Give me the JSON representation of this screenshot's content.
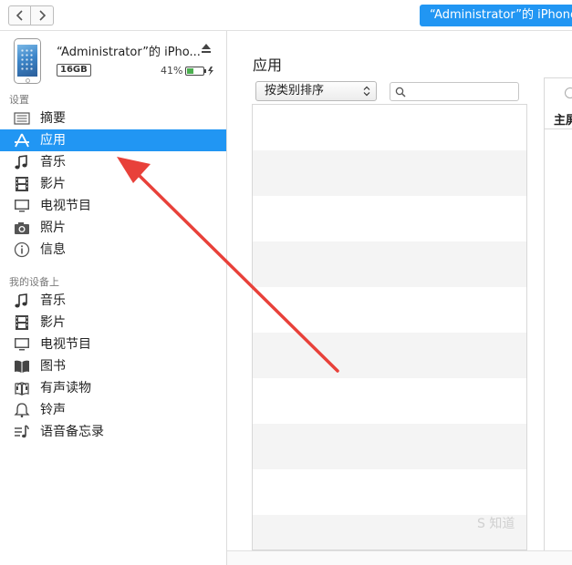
{
  "toolbar": {
    "back_icon": "chevron-left-icon",
    "forward_icon": "chevron-right-icon",
    "device_button_label": "“Administrator”的 iPhone"
  },
  "device": {
    "name": "“Administrator”的 iPho...",
    "capacity": "16GB",
    "battery_percent": "41%",
    "battery_level": 0.41,
    "eject_icon": "eject-icon"
  },
  "sidebar": {
    "settings_label": "设置",
    "settings_items": [
      {
        "label": "摘要",
        "icon": "list-icon"
      },
      {
        "label": "应用",
        "icon": "app-store-icon",
        "active": true
      },
      {
        "label": "音乐",
        "icon": "music-note-icon"
      },
      {
        "label": "影片",
        "icon": "film-icon"
      },
      {
        "label": "电视节目",
        "icon": "tv-icon"
      },
      {
        "label": "照片",
        "icon": "camera-icon"
      },
      {
        "label": "信息",
        "icon": "info-icon"
      }
    ],
    "device_label": "我的设备上",
    "device_items": [
      {
        "label": "音乐",
        "icon": "music-note-icon"
      },
      {
        "label": "影片",
        "icon": "film-icon"
      },
      {
        "label": "电视节目",
        "icon": "tv-icon"
      },
      {
        "label": "图书",
        "icon": "book-icon"
      },
      {
        "label": "有声读物",
        "icon": "audiobook-icon"
      },
      {
        "label": "铃声",
        "icon": "bell-icon"
      },
      {
        "label": "语音备忘录",
        "icon": "voice-memo-icon"
      }
    ]
  },
  "main": {
    "title": "应用",
    "sort_select": "按类别排序",
    "search_placeholder": "",
    "home_screen_label": "主屏"
  },
  "watermark": "S 知道",
  "colors": {
    "accent": "#2196f3",
    "annotation_arrow": "#e8413a",
    "battery": "#4caf50"
  }
}
